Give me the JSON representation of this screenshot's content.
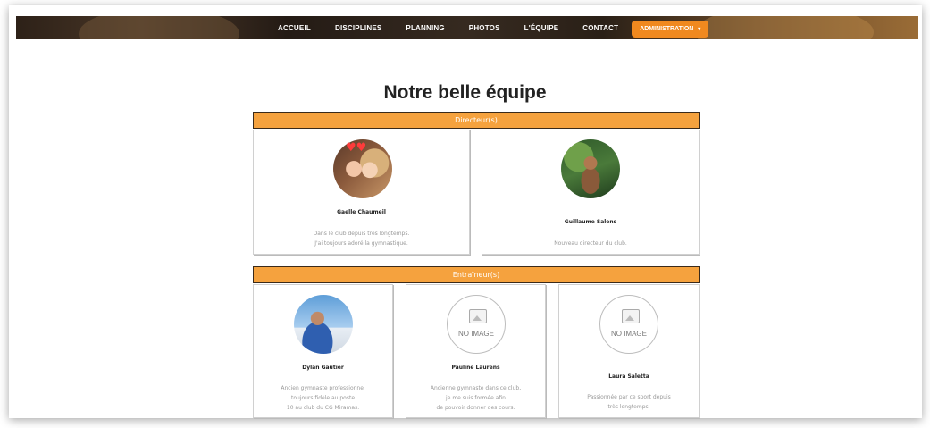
{
  "nav": {
    "items": [
      "ACCUEIL",
      "DISCIPLINES",
      "PLANNING",
      "PHOTOS",
      "L'ÉQUIPE",
      "CONTACT"
    ],
    "admin_label": "ADMINISTRATION",
    "admin_caret": "▾"
  },
  "page": {
    "title": "Notre belle équipe"
  },
  "sections": {
    "directors": {
      "title": "Directeur(s)",
      "members": [
        {
          "name": "Gaelle Chaumeil",
          "desc_lines": [
            "Dans le club depuis très longtemps.",
            "J'ai toujours adoré la gymnastique."
          ],
          "hearts": "♥♥"
        },
        {
          "name": "Guillaume Salens",
          "desc_lines": [
            "Nouveau directeur du club."
          ]
        }
      ]
    },
    "trainers": {
      "title": "Entraîneur(s)",
      "members": [
        {
          "name": "Dylan Gautier",
          "desc_lines": [
            "Ancien gymnaste professionnel",
            "toujours fidèle au poste",
            "10 au club du CG Miramas."
          ]
        },
        {
          "name": "Pauline Laurens",
          "no_image": "NO IMAGE",
          "desc_lines": [
            "Ancienne gymnaste dans ce club,",
            "je me suis formée afin",
            "de pouvoir donner des cours."
          ]
        },
        {
          "name": "Laura Saletta",
          "no_image": "NO IMAGE",
          "desc_lines": [
            "Passionnée par ce sport depuis",
            "très longtemps."
          ]
        }
      ]
    }
  }
}
